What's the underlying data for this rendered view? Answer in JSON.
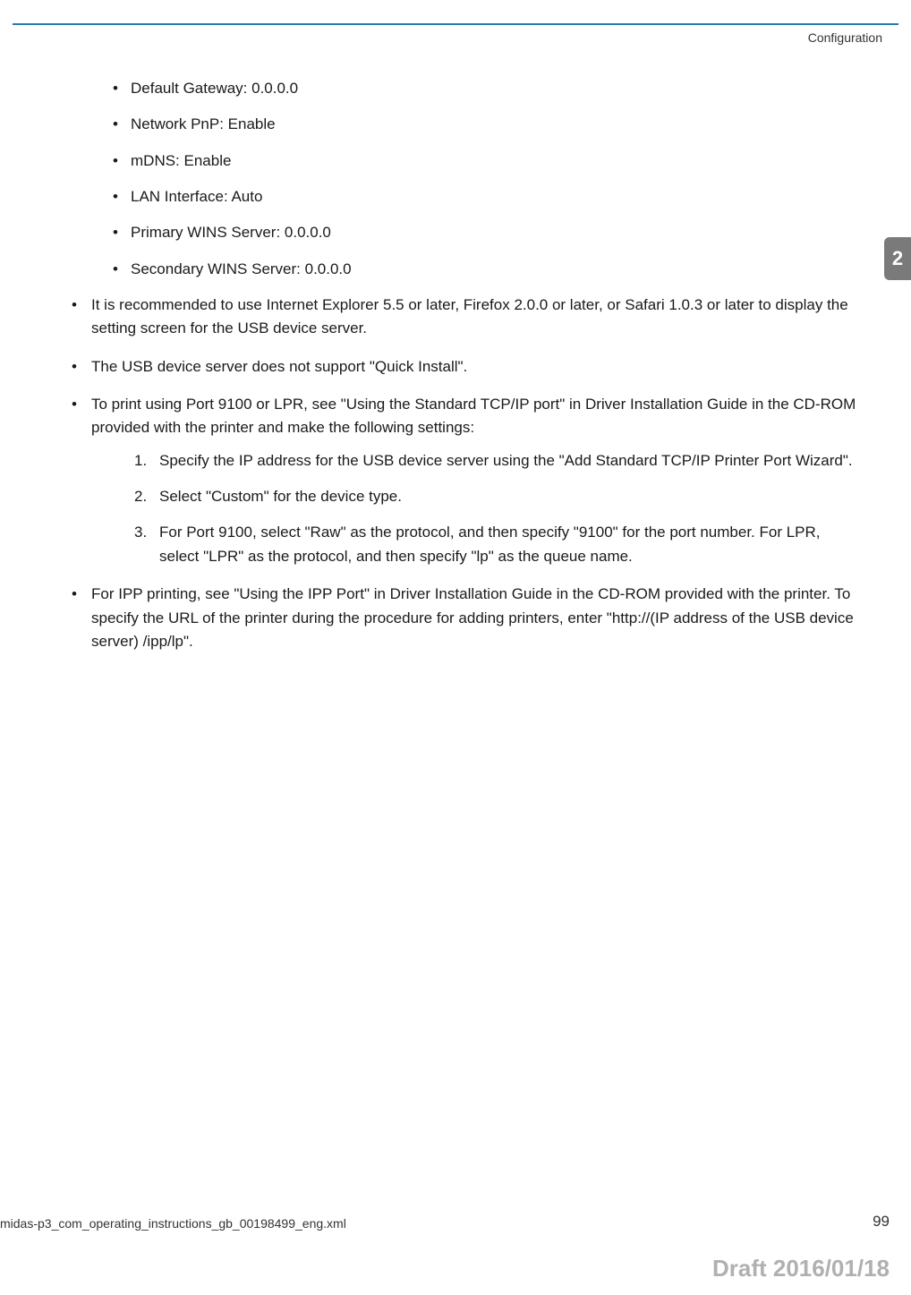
{
  "header": {
    "section_title": "Configuration"
  },
  "chapter": {
    "number": "2"
  },
  "content": {
    "inner_bullets": [
      "Default Gateway: 0.0.0.0",
      "Network PnP: Enable",
      "mDNS: Enable",
      "LAN Interface: Auto",
      "Primary WINS Server: 0.0.0.0",
      "Secondary WINS Server: 0.0.0.0"
    ],
    "outer_bullets": [
      {
        "text": "It is recommended to use Internet Explorer 5.5 or later, Firefox 2.0.0 or later, or Safari 1.0.3 or later to display the setting screen for the USB device server."
      },
      {
        "text": "The USB device server does not support \"Quick Install\"."
      },
      {
        "text": "To print using Port 9100 or LPR, see \"Using the Standard TCP/IP port\" in Driver Installation Guide in the CD-ROM provided with the printer and make the following settings:",
        "numbered": [
          "Specify the IP address for the USB device server using the \"Add Standard TCP/IP Printer Port Wizard\".",
          "Select \"Custom\" for the device type.",
          "For Port 9100, select \"Raw\" as the protocol, and then specify \"9100\" for the port number. For LPR, select \"LPR\" as the protocol, and then specify \"lp\" as the queue name."
        ]
      },
      {
        "text": "For IPP printing, see \"Using the IPP Port\" in Driver Installation Guide in the CD-ROM provided with the printer. To specify the URL of the printer during the procedure for adding printers, enter \"http://(IP address of the USB device server) /ipp/lp\"."
      }
    ]
  },
  "footer": {
    "filename": "midas-p3_com_operating_instructions_gb_00198499_eng.xml",
    "page_number": "99",
    "draft_stamp": "Draft 2016/01/18"
  }
}
